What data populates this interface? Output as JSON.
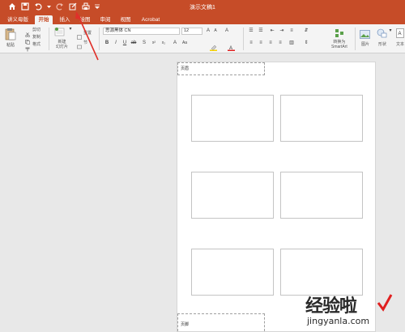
{
  "window": {
    "title": "演示文稿1"
  },
  "quick_access": [
    "home-icon",
    "save-icon",
    "undo-icon",
    "undo-dropdown-icon",
    "redo-icon",
    "edit-icon",
    "print-icon",
    "customize-icon"
  ],
  "tabs": [
    {
      "label": "讲义母版",
      "active": false
    },
    {
      "label": "开始",
      "active": true
    },
    {
      "label": "插入",
      "active": false
    },
    {
      "label": "绘图",
      "active": false
    },
    {
      "label": "审阅",
      "active": false
    },
    {
      "label": "视图",
      "active": false
    },
    {
      "label": "Acrobat",
      "active": false
    }
  ],
  "ribbon": {
    "paste_label": "粘贴",
    "cut_label": "剪切",
    "copy_label": "复制",
    "format_label": "格式",
    "new_slide_label": "新建\n幻灯片",
    "reset_label": "重置",
    "section_label": "节",
    "font_name": "思源黑体 CN",
    "font_size": "12",
    "convert_smartart_label": "转换为\nSmartArt",
    "picture_label": "图片",
    "shapes_label": "形状",
    "textbox_label": "文本"
  },
  "page": {
    "header_label": "页眉",
    "footer_label": "页脚"
  },
  "watermark": {
    "text": "经验啦",
    "url": "jingyanla.com"
  },
  "colors": {
    "titlebar": "#c64c28",
    "active_tab_text": "#c64c28",
    "arrow": "#e0302a",
    "highlight_yellow": "#f5d000",
    "font_red": "#e02020"
  }
}
